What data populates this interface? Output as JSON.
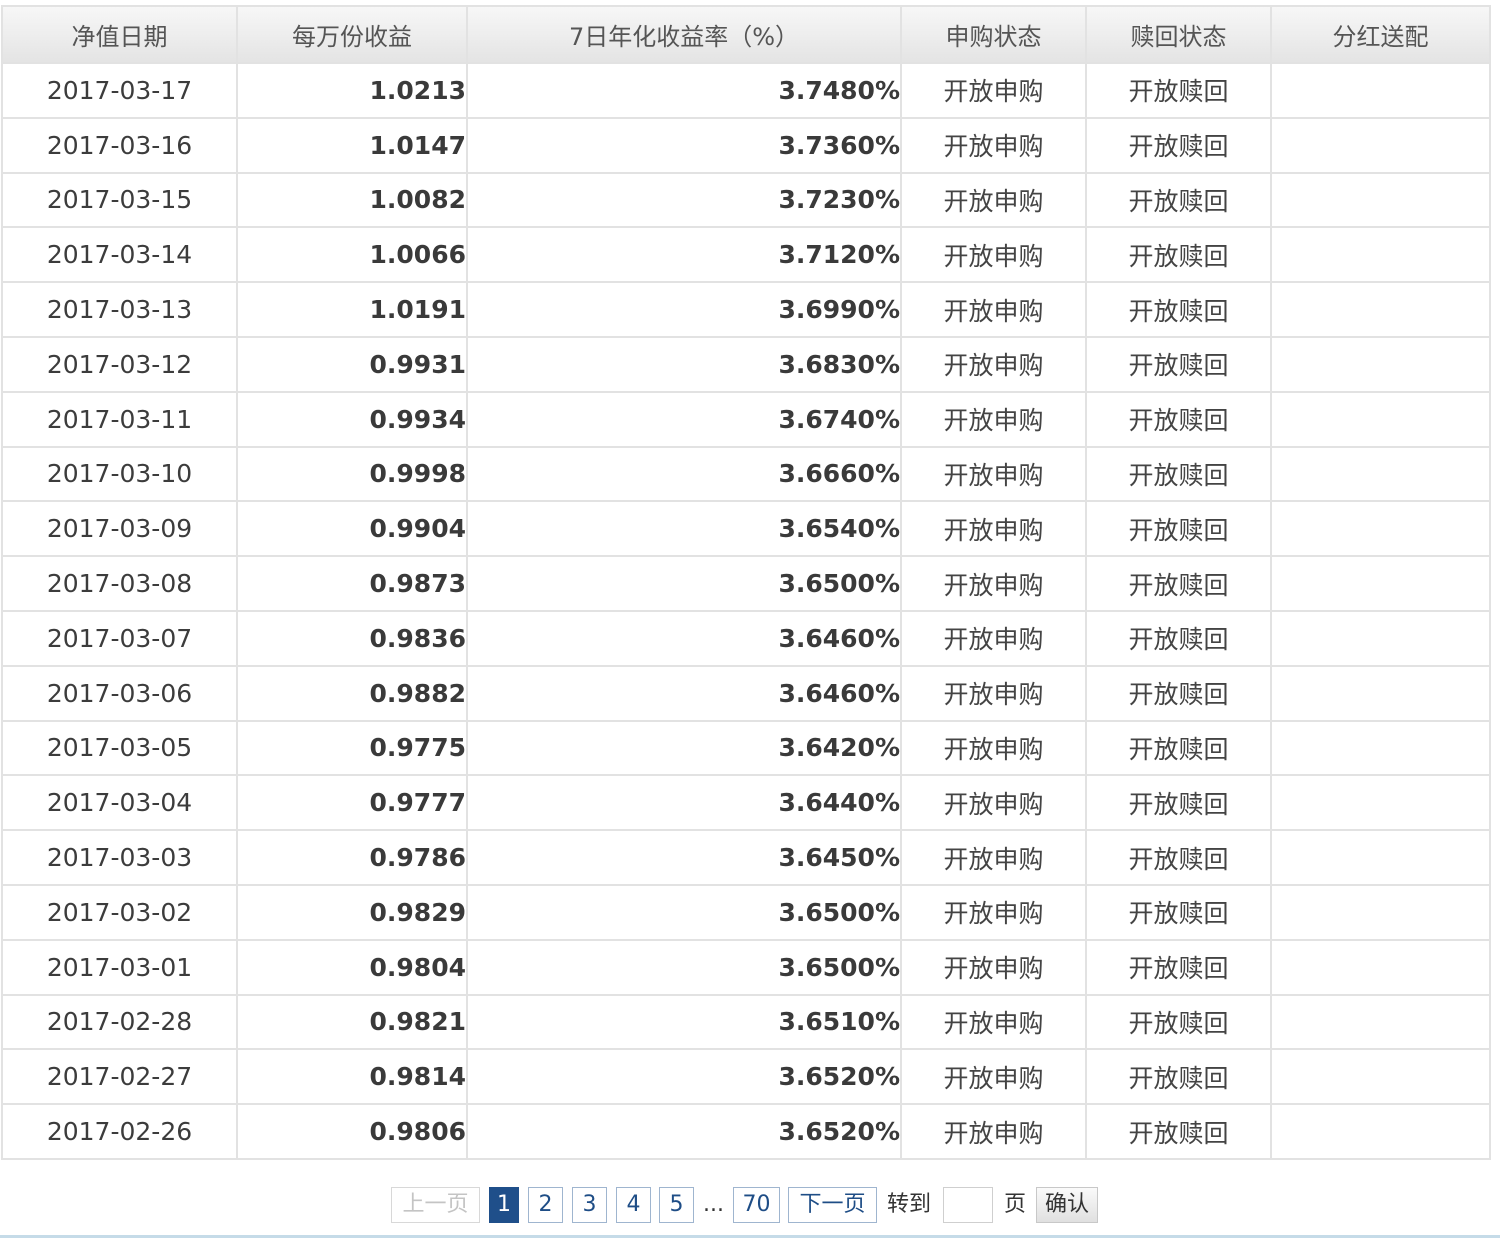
{
  "table": {
    "headers": [
      "净值日期",
      "每万份收益",
      "7日年化收益率（%）",
      "申购状态",
      "赎回状态",
      "分红送配"
    ],
    "rows": [
      {
        "date": "2017-03-17",
        "per10k": "1.0213",
        "yield7d": "3.7480%",
        "subscribe": "开放申购",
        "redeem": "开放赎回",
        "dividend": ""
      },
      {
        "date": "2017-03-16",
        "per10k": "1.0147",
        "yield7d": "3.7360%",
        "subscribe": "开放申购",
        "redeem": "开放赎回",
        "dividend": ""
      },
      {
        "date": "2017-03-15",
        "per10k": "1.0082",
        "yield7d": "3.7230%",
        "subscribe": "开放申购",
        "redeem": "开放赎回",
        "dividend": ""
      },
      {
        "date": "2017-03-14",
        "per10k": "1.0066",
        "yield7d": "3.7120%",
        "subscribe": "开放申购",
        "redeem": "开放赎回",
        "dividend": ""
      },
      {
        "date": "2017-03-13",
        "per10k": "1.0191",
        "yield7d": "3.6990%",
        "subscribe": "开放申购",
        "redeem": "开放赎回",
        "dividend": ""
      },
      {
        "date": "2017-03-12",
        "per10k": "0.9931",
        "yield7d": "3.6830%",
        "subscribe": "开放申购",
        "redeem": "开放赎回",
        "dividend": ""
      },
      {
        "date": "2017-03-11",
        "per10k": "0.9934",
        "yield7d": "3.6740%",
        "subscribe": "开放申购",
        "redeem": "开放赎回",
        "dividend": ""
      },
      {
        "date": "2017-03-10",
        "per10k": "0.9998",
        "yield7d": "3.6660%",
        "subscribe": "开放申购",
        "redeem": "开放赎回",
        "dividend": ""
      },
      {
        "date": "2017-03-09",
        "per10k": "0.9904",
        "yield7d": "3.6540%",
        "subscribe": "开放申购",
        "redeem": "开放赎回",
        "dividend": ""
      },
      {
        "date": "2017-03-08",
        "per10k": "0.9873",
        "yield7d": "3.6500%",
        "subscribe": "开放申购",
        "redeem": "开放赎回",
        "dividend": ""
      },
      {
        "date": "2017-03-07",
        "per10k": "0.9836",
        "yield7d": "3.6460%",
        "subscribe": "开放申购",
        "redeem": "开放赎回",
        "dividend": ""
      },
      {
        "date": "2017-03-06",
        "per10k": "0.9882",
        "yield7d": "3.6460%",
        "subscribe": "开放申购",
        "redeem": "开放赎回",
        "dividend": ""
      },
      {
        "date": "2017-03-05",
        "per10k": "0.9775",
        "yield7d": "3.6420%",
        "subscribe": "开放申购",
        "redeem": "开放赎回",
        "dividend": ""
      },
      {
        "date": "2017-03-04",
        "per10k": "0.9777",
        "yield7d": "3.6440%",
        "subscribe": "开放申购",
        "redeem": "开放赎回",
        "dividend": ""
      },
      {
        "date": "2017-03-03",
        "per10k": "0.9786",
        "yield7d": "3.6450%",
        "subscribe": "开放申购",
        "redeem": "开放赎回",
        "dividend": ""
      },
      {
        "date": "2017-03-02",
        "per10k": "0.9829",
        "yield7d": "3.6500%",
        "subscribe": "开放申购",
        "redeem": "开放赎回",
        "dividend": ""
      },
      {
        "date": "2017-03-01",
        "per10k": "0.9804",
        "yield7d": "3.6500%",
        "subscribe": "开放申购",
        "redeem": "开放赎回",
        "dividend": ""
      },
      {
        "date": "2017-02-28",
        "per10k": "0.9821",
        "yield7d": "3.6510%",
        "subscribe": "开放申购",
        "redeem": "开放赎回",
        "dividend": ""
      },
      {
        "date": "2017-02-27",
        "per10k": "0.9814",
        "yield7d": "3.6520%",
        "subscribe": "开放申购",
        "redeem": "开放赎回",
        "dividend": ""
      },
      {
        "date": "2017-02-26",
        "per10k": "0.9806",
        "yield7d": "3.6520%",
        "subscribe": "开放申购",
        "redeem": "开放赎回",
        "dividend": ""
      }
    ]
  },
  "pagination": {
    "prev_label": "上一页",
    "pages": [
      "1",
      "2",
      "3",
      "4",
      "5"
    ],
    "current_page": "1",
    "ellipsis": "...",
    "last_page": "70",
    "next_label": "下一页",
    "goto_label": "转到",
    "goto_value": "",
    "page_unit": "页",
    "confirm_label": "确认"
  },
  "colors": {
    "header_bg": "#e8e8e8",
    "border": "#e2e2e2",
    "active_page_bg": "#1f4f8a",
    "pager_border": "#9fb5cf",
    "accent_line": "#c5dbe8"
  }
}
